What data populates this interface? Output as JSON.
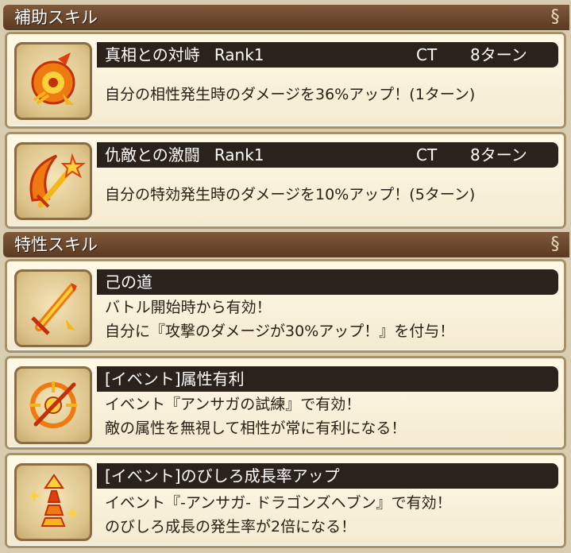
{
  "sections": {
    "support": {
      "title": "補助スキル"
    },
    "trait": {
      "title": "特性スキル"
    }
  },
  "support_skills": [
    {
      "name": "真相との対峙",
      "rank": "Rank1",
      "ct_label": "CT",
      "turns": "8ターン",
      "description": "自分の相性発生時のダメージを36%アップ！(1ターン)",
      "icon": "crest-target-icon"
    },
    {
      "name": "仇敵との激闘",
      "rank": "Rank1",
      "ct_label": "CT",
      "turns": "8ターン",
      "description": "自分の特効発生時のダメージを10%アップ！(5ターン)",
      "icon": "crescent-sword-icon"
    }
  ],
  "trait_skills": [
    {
      "name": "己の道",
      "line1": "バトル開始時から有効！",
      "line2": "自分に『攻撃のダメージが30%アップ！』を付与！",
      "icon": "flaming-sword-icon"
    },
    {
      "name": "[イベント]属性有利",
      "line1": "イベント『アンサガの試練』で有効！",
      "line2": "敵の属性を無視して相性が常に有利になる！",
      "icon": "crosshair-sword-icon"
    },
    {
      "name": "[イベント]のびしろ成長率アップ",
      "line1": "イベント『-アンサガ- ドラゴンズヘブン』で有効！",
      "line2": "のびしろ成長の発生率が2倍になる！",
      "icon": "rising-spiral-icon"
    }
  ],
  "colors": {
    "background": "#d9cdb1",
    "header": "#6b4a2e",
    "name_bar": "#2b221c",
    "card": "#fbf3dc",
    "icon_orange": "#f07a12"
  }
}
